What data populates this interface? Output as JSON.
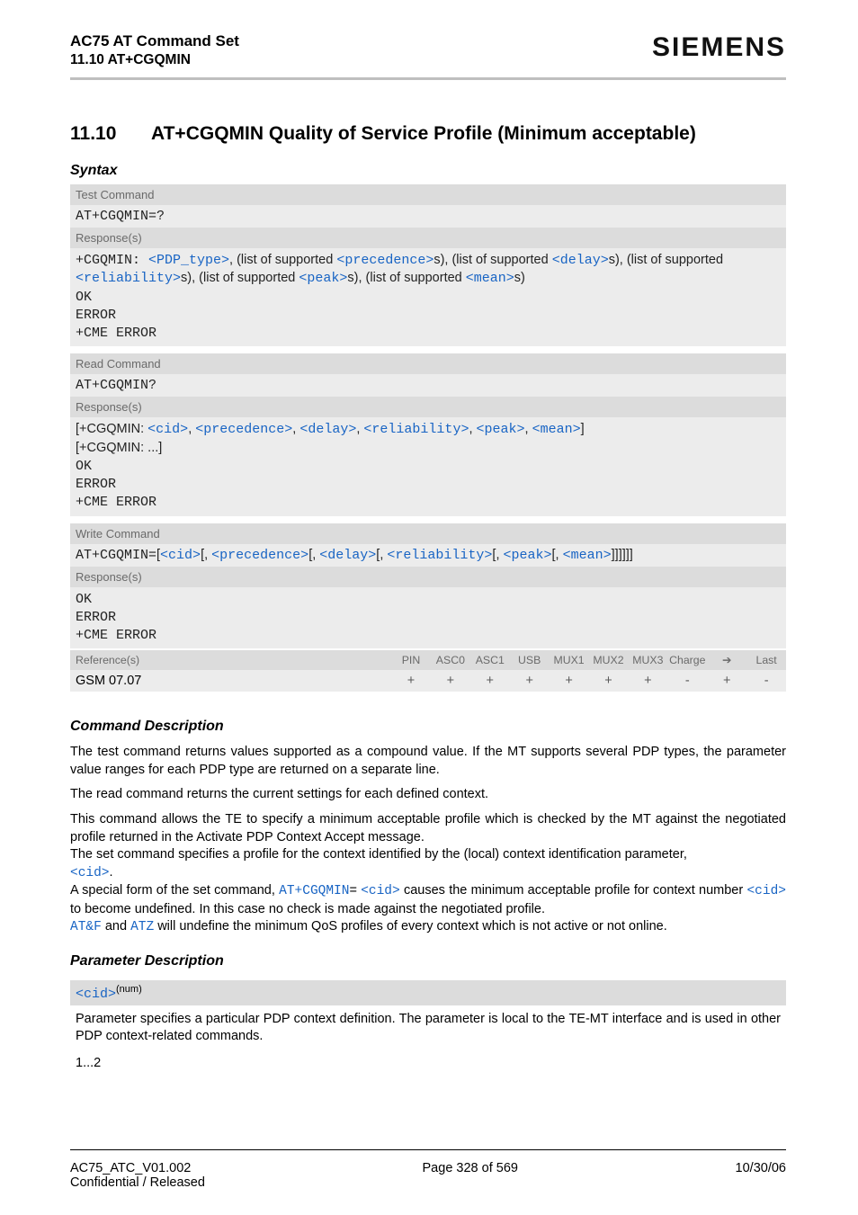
{
  "header": {
    "doc_title": "AC75 AT Command Set",
    "section_ref": "11.10 AT+CGQMIN",
    "brand": "SIEMENS"
  },
  "heading": {
    "number": "11.10",
    "title": "AT+CGQMIN   Quality of Service Profile (Minimum acceptable)"
  },
  "syntax_label": "Syntax",
  "blocks": {
    "test": {
      "label": "Test Command",
      "command": "AT+CGQMIN=?",
      "resp_label": "Response(s)",
      "line_prefix": "+CGQMIN: ",
      "pdp_type": "<PDP_type>",
      "precedence": "<precedence>",
      "delay": "<delay>",
      "reliability": "<reliability>",
      "peak": "<peak>",
      "mean": "<mean>",
      "list_text": ", (list of supported ",
      "list_text_first": "s), (list of supported ",
      "list_close": "s)",
      "ok": "OK",
      "error": "ERROR",
      "cme": "+CME ERROR"
    },
    "read": {
      "label": "Read Command",
      "command": "AT+CGQMIN?",
      "resp_label": "Response(s)",
      "line_open": "[+CGQMIN: ",
      "cid": "<cid>",
      "precedence": "<precedence>",
      "delay": "<delay>",
      "reliability": "<reliability>",
      "peak": "<peak>",
      "mean": "<mean>",
      "line_close": "]",
      "more": "[+CGQMIN: ...]",
      "ok": "OK",
      "error": "ERROR",
      "cme": "+CME ERROR"
    },
    "write": {
      "label": "Write Command",
      "cmd_prefix": "AT+CGQMIN=",
      "cid": "<cid>",
      "precedence": "<precedence>",
      "delay": "<delay>",
      "reliability": "<reliability>",
      "peak": "<peak>",
      "mean": "<mean>",
      "brackets_close": "]]]]]]",
      "resp_label": "Response(s)",
      "ok": "OK",
      "error": "ERROR",
      "cme": "+CME ERROR"
    }
  },
  "ref_table": {
    "ref_header": "Reference(s)",
    "ref_value": "GSM 07.07",
    "cols": [
      "PIN",
      "ASC0",
      "ASC1",
      "USB",
      "MUX1",
      "MUX2",
      "MUX3",
      "Charge",
      "➔",
      "Last"
    ],
    "vals": [
      "+",
      "+",
      "+",
      "+",
      "+",
      "+",
      "+",
      "-",
      "+",
      "-"
    ]
  },
  "cmd_desc_label": "Command Description",
  "desc": {
    "p1": "The test command returns values supported as a compound value. If the MT supports several PDP types, the parameter value ranges for each PDP type are returned on a separate line.",
    "p2": "The read command returns the current settings for each defined context.",
    "p3a": "This command allows the TE to specify a minimum acceptable profile which is checked by the MT against the negotiated profile returned in the Activate PDP Context Accept message.",
    "p3b_pre": "The set command specifies a profile for the context identified by the (local) context identification parameter, ",
    "p3b_cid": "<cid>",
    "p3b_post": ".",
    "p4_pre": "A special form of the set command, ",
    "p4_cmd": "AT+CGQMIN",
    "p4_eq": "= ",
    "p4_cid": "<cid>",
    "p4_mid": " causes the minimum acceptable profile for context number ",
    "p4_cid2": "<cid>",
    "p4_post": " to become undefined. In this case no check is made against the negotiated profile.",
    "p5_atf": "AT&F",
    "p5_and": " and ",
    "p5_atz": "ATZ",
    "p5_post": " will undefine the minimum QoS profiles of every context which is not active or not online."
  },
  "param_desc_label": "Parameter Description",
  "param_box": {
    "name": "<cid>",
    "sup": "(num)",
    "body": "Parameter specifies a particular PDP context definition. The parameter is local to the TE-MT interface and is used in other PDP context-related commands.",
    "range": "1...2"
  },
  "footer": {
    "left1": "AC75_ATC_V01.002",
    "left2": "Confidential / Released",
    "mid": "Page 328 of 569",
    "right": "10/30/06"
  }
}
